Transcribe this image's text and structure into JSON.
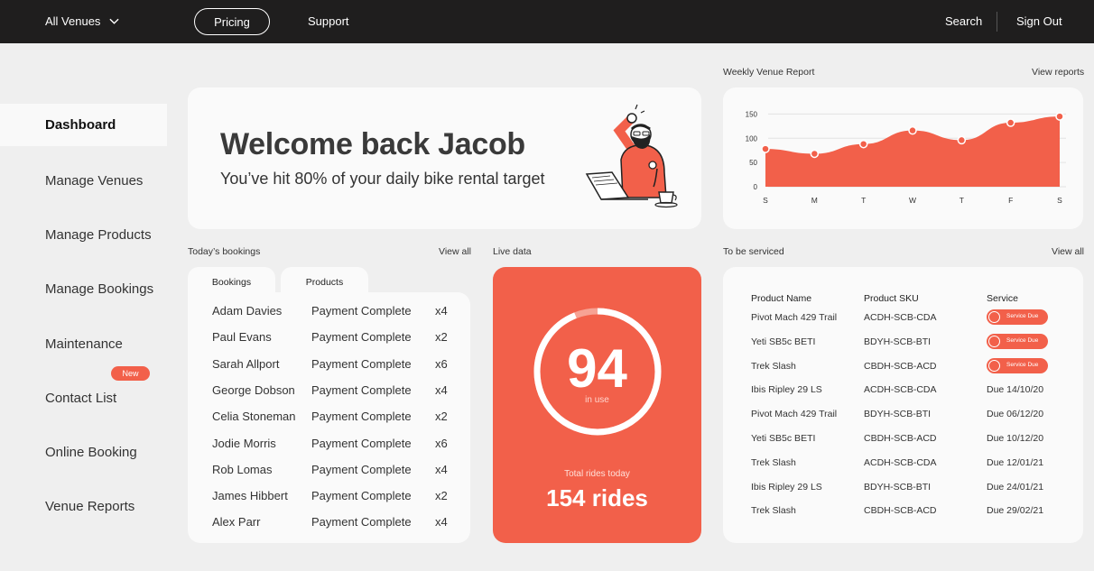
{
  "topbar": {
    "venues_label": "All Venues",
    "pricing_label": "Pricing",
    "support_label": "Support",
    "search_label": "Search",
    "signout_label": "Sign Out"
  },
  "sidebar": {
    "items": [
      {
        "label": "Dashboard",
        "active": true
      },
      {
        "label": "Manage Venues"
      },
      {
        "label": "Manage Products"
      },
      {
        "label": "Manage Bookings"
      },
      {
        "label": "Maintenance"
      },
      {
        "label": "Contact List"
      },
      {
        "label": "Online Booking"
      },
      {
        "label": "Venue Reports"
      }
    ],
    "new_badge": "New"
  },
  "welcome": {
    "title": "Welcome back Jacob",
    "subtitle": "You’ve hit 80% of your daily bike rental target"
  },
  "report": {
    "label": "Weekly Venue Report",
    "link": "View reports"
  },
  "chart_data": {
    "type": "area",
    "categories": [
      "S",
      "M",
      "T",
      "W",
      "T",
      "F",
      "S"
    ],
    "values": [
      78,
      68,
      88,
      116,
      96,
      132,
      145
    ],
    "yticks": [
      0,
      50,
      100,
      150
    ],
    "ylim": [
      0,
      160
    ],
    "color": "#f2604a"
  },
  "bookings": {
    "label": "Today’s bookings",
    "link": "View all",
    "tabs": [
      "Bookings",
      "Products"
    ],
    "rows": [
      {
        "name": "Adam Davies",
        "status": "Payment Complete",
        "qty": "x4"
      },
      {
        "name": "Paul Evans",
        "status": "Payment Complete",
        "qty": "x2"
      },
      {
        "name": "Sarah Allport",
        "status": "Payment Complete",
        "qty": "x6"
      },
      {
        "name": "George Dobson",
        "status": "Payment Complete",
        "qty": "x4"
      },
      {
        "name": "Celia Stoneman",
        "status": "Payment Complete",
        "qty": "x2"
      },
      {
        "name": "Jodie Morris",
        "status": "Payment Complete",
        "qty": "x6"
      },
      {
        "name": "Rob Lomas",
        "status": "Payment Complete",
        "qty": "x4"
      },
      {
        "name": "James Hibbert",
        "status": "Payment Complete",
        "qty": "x2"
      },
      {
        "name": "Alex Parr",
        "status": "Payment Complete",
        "qty": "x4"
      }
    ]
  },
  "live": {
    "label": "Live data",
    "in_use_value": "94",
    "in_use_label": "in use",
    "ring_progress": 0.94,
    "total_label": "Total rides today",
    "total_value": "154 rides"
  },
  "service": {
    "label": "To be serviced",
    "link": "View all",
    "headers": [
      "Product Name",
      "Product SKU",
      "Service"
    ],
    "due_label": "Service Due",
    "rows": [
      {
        "name": "Pivot Mach 429 Trail",
        "sku": "ACDH-SCB-CDA",
        "service": "",
        "due": true
      },
      {
        "name": "Yeti SB5c BETI",
        "sku": "BDYH-SCB-BTI",
        "service": "",
        "due": true
      },
      {
        "name": "Trek Slash",
        "sku": "CBDH-SCB-ACD",
        "service": "",
        "due": true
      },
      {
        "name": "Ibis Ripley 29 LS",
        "sku": "ACDH-SCB-CDA",
        "service": "Due 14/10/20",
        "due": false
      },
      {
        "name": "Pivot Mach 429 Trail",
        "sku": "BDYH-SCB-BTI",
        "service": "Due 06/12/20",
        "due": false
      },
      {
        "name": "Yeti SB5c BETI",
        "sku": "CBDH-SCB-ACD",
        "service": "Due 10/12/20",
        "due": false
      },
      {
        "name": "Trek Slash",
        "sku": "ACDH-SCB-CDA",
        "service": "Due 12/01/21",
        "due": false
      },
      {
        "name": "Ibis Ripley 29 LS",
        "sku": "BDYH-SCB-BTI",
        "service": "Due 24/01/21",
        "due": false
      },
      {
        "name": "Trek Slash",
        "sku": "CBDH-SCB-ACD",
        "service": "Due 29/02/21",
        "due": false
      }
    ]
  }
}
